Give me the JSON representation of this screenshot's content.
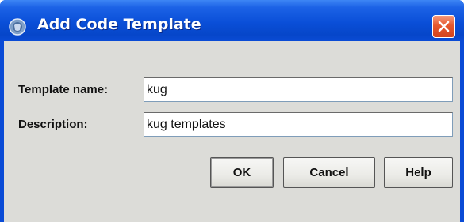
{
  "window": {
    "title": "Add Code Template",
    "icon": "java-cup-icon",
    "close_icon": "close-icon"
  },
  "form": {
    "template_name_label": "Template name:",
    "template_name_value": "kug",
    "description_label": "Description:",
    "description_value": "kug templates"
  },
  "buttons": {
    "ok_label": "OK",
    "cancel_label": "Cancel",
    "help_label": "Help"
  },
  "colors": {
    "titlebar": "#0a4bd6",
    "client_background": "#dcdcd8",
    "close_button": "#e5592f"
  }
}
